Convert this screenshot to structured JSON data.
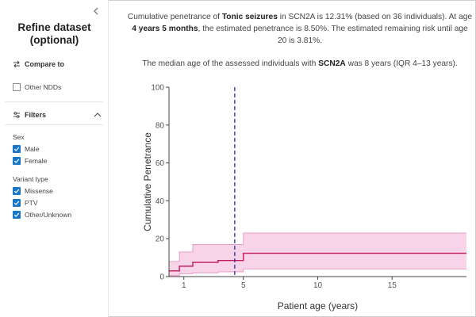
{
  "sidebar": {
    "collapse_icon": "chevron-left-icon",
    "title_line1": "Refine dataset",
    "title_line2": "(optional)",
    "compare_label": "Compare to",
    "compare_icon": "swap-arrows-icon",
    "compare_options": [
      {
        "label": "Other NDDs",
        "checked": false
      }
    ],
    "filters_label": "Filters",
    "filters_icon": "sliders-icon",
    "filters_expanded": true,
    "sex_label": "Sex",
    "sex_options": [
      {
        "label": "Male",
        "checked": true
      },
      {
        "label": "Female",
        "checked": true
      }
    ],
    "variant_label": "Variant type",
    "variant_options": [
      {
        "label": "Missense",
        "checked": true
      },
      {
        "label": "PTV",
        "checked": true
      },
      {
        "label": "Other/Unknown",
        "checked": true
      }
    ]
  },
  "summary": {
    "s1": "Cumulative penetrance of ",
    "s2": "Tonic seizures",
    "s3": " in SCN2A is 12.31% (based on 36 individuals). At age ",
    "s4": "4 years 5 months",
    "s5": ", the estimated penetrance is 8.50%. The estimated remaining risk until age 20 is 3.81%."
  },
  "median": {
    "m1": "The median age of the assessed individuals with ",
    "m2": "SCN2A",
    "m3": " was 8 years (IQR 4–13 years)."
  },
  "colors": {
    "line": "#c2185b",
    "band": "#f5c6e0",
    "band_edge": "#e48bbd",
    "marker": "#1f2db8",
    "accent": "#1a76c7"
  },
  "chart_data": {
    "type": "line",
    "xlabel": "Patient age (years)",
    "ylabel": "Cumulative Penetrance",
    "xlim": [
      0,
      20
    ],
    "ylim": [
      0,
      100
    ],
    "x_ticks": [
      1,
      5,
      10,
      15
    ],
    "y_ticks": [
      0,
      20,
      40,
      60,
      80,
      100
    ],
    "grid": false,
    "marker_x": 4.42,
    "series": [
      {
        "steps": [
          {
            "x": 0,
            "y": 3,
            "lo": 0.5,
            "hi": 8
          },
          {
            "x": 0.7,
            "y": 5.5,
            "lo": 1.5,
            "hi": 13
          },
          {
            "x": 1.6,
            "y": 7.5,
            "lo": 2,
            "hi": 17
          },
          {
            "x": 3.3,
            "y": 8.5,
            "lo": 2.5,
            "hi": 17
          },
          {
            "x": 5,
            "y": 12.31,
            "lo": 4,
            "hi": 23
          },
          {
            "x": 20,
            "y": 12.31,
            "lo": 4,
            "hi": 23
          }
        ]
      }
    ]
  }
}
